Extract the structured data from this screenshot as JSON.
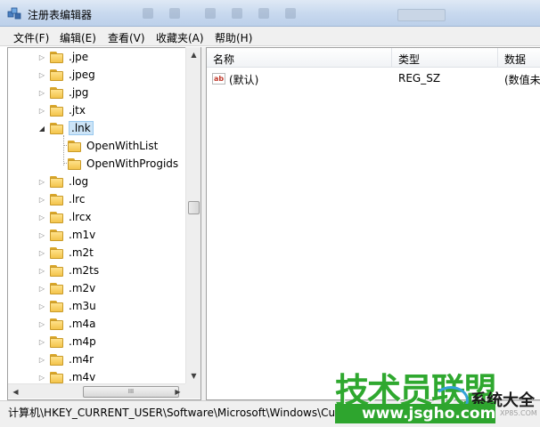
{
  "window": {
    "title": "注册表编辑器"
  },
  "menu": [
    "文件(F)",
    "编辑(E)",
    "查看(V)",
    "收藏夹(A)",
    "帮助(H)"
  ],
  "tree": {
    "items": [
      {
        "label": ".jpe",
        "expander": "▷"
      },
      {
        "label": ".jpeg",
        "expander": "▷"
      },
      {
        "label": ".jpg",
        "expander": "▷"
      },
      {
        "label": ".jtx",
        "expander": "▷"
      },
      {
        "label": ".lnk",
        "expander": "◢",
        "selected": true
      },
      {
        "label": "OpenWithList",
        "child": true
      },
      {
        "label": "OpenWithProgids",
        "child": true
      },
      {
        "label": ".log",
        "expander": "▷"
      },
      {
        "label": ".lrc",
        "expander": "▷"
      },
      {
        "label": ".lrcx",
        "expander": "▷"
      },
      {
        "label": ".m1v",
        "expander": "▷"
      },
      {
        "label": ".m2t",
        "expander": "▷"
      },
      {
        "label": ".m2ts",
        "expander": "▷"
      },
      {
        "label": ".m2v",
        "expander": "▷"
      },
      {
        "label": ".m3u",
        "expander": "▷"
      },
      {
        "label": ".m4a",
        "expander": "▷"
      },
      {
        "label": ".m4p",
        "expander": "▷"
      },
      {
        "label": ".m4r",
        "expander": "▷"
      },
      {
        "label": ".m4v",
        "expander": "▷"
      }
    ],
    "scroll_up": "▲",
    "scroll_down": "▼",
    "scroll_left": "◀",
    "scroll_right": "▶",
    "hthumb_grip": "III"
  },
  "list": {
    "headers": [
      "名称",
      "类型",
      "数据"
    ],
    "rows": [
      {
        "icon": "ab",
        "name": "(默认)",
        "type": "REG_SZ",
        "data": "(数值未"
      }
    ]
  },
  "status": {
    "path": "计算机\\HKEY_CURRENT_USER\\Software\\Microsoft\\Windows\\Cur"
  },
  "watermark": {
    "title": "技术员联盟",
    "side": "系统大全",
    "url": "www.jsgho.com",
    "small": "XP85.COM"
  },
  "icons": {
    "app": "registry-editor-icon",
    "folder": "folder-icon",
    "value": "string-value-icon"
  }
}
